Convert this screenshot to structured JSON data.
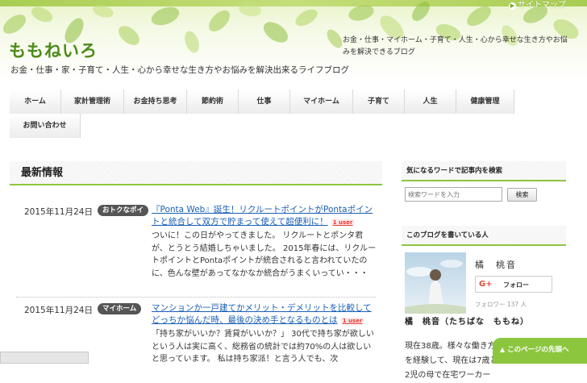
{
  "header": {
    "site_title": "ももねいろ",
    "tagline": "お金・仕事・家・子育て・人生・心から幸せな生き方やお悩みを解決出来るライフブログ",
    "description": "お金・仕事・マイホーム・子育て・人生・心から幸せな生き方やお悩みを解決できるブログ",
    "sitemap_link": "サイトマップ"
  },
  "nav": {
    "items": [
      {
        "label": "ホーム"
      },
      {
        "label": "家計管理術"
      },
      {
        "label": "お金持ち思考"
      },
      {
        "label": "節約術"
      },
      {
        "label": "仕事"
      },
      {
        "label": "マイホーム"
      },
      {
        "label": "子育て"
      },
      {
        "label": "人生"
      },
      {
        "label": "健康管理"
      },
      {
        "label": "お問い合わせ"
      }
    ]
  },
  "main": {
    "section_title": "最新情報",
    "posts": [
      {
        "date": "2015年11月24日",
        "category": "おトクなポイ",
        "title": "『Ponta Web』誕生！リクルートポイントがPontaポイントと統合して双方で貯まって使えて超便利に！",
        "badge": "1 user",
        "excerpt": "ついに！この日がやってきました。 リクルートとポンタ君が、とうとう結婚しちゃいました。 2015年春には、リクルートポイントとPontaポイントが統合されると言われていたのに、色んな壁があってなかなか統合がうまくいってい・・・"
      },
      {
        "date": "2015年11月24日",
        "category": "マイホーム",
        "title": "マンションか一戸建てかメリット・デメリットを比較してどっちか悩んだ時、最後の決め手となるものとは",
        "badge": "1 user",
        "excerpt": "「持ち家がいいか？賃貸がいいか？」 30代で持ち家が欲しいという人は実に高く、総務省の統計では約70%の人は欲しいと思っています。 私は持ち家派！と言う人でも、次"
      }
    ]
  },
  "sidebar": {
    "search": {
      "heading": "気になるワードで記事内を検索",
      "placeholder": "検索ワードを入力",
      "button_label": "検索"
    },
    "author": {
      "heading": "このブログを書いている人",
      "name": "橘　桃音",
      "follow_label": "フォロー",
      "gplus_label": "G+",
      "follower_count": "フォロワー 137 人",
      "full_name": "橘　桃音（たちばな　ももね）",
      "bio": "現在38歳。様々な働き方を経験して、現在は7歳と2児の母で在宅ワーカー"
    }
  },
  "ui": {
    "back_to_top": "このページの先頭へ"
  },
  "colors": {
    "accent_green": "#8cc63f",
    "logo_green": "#4c8a18",
    "link_blue": "#1a5fb4",
    "badge_red": "#e53935"
  }
}
